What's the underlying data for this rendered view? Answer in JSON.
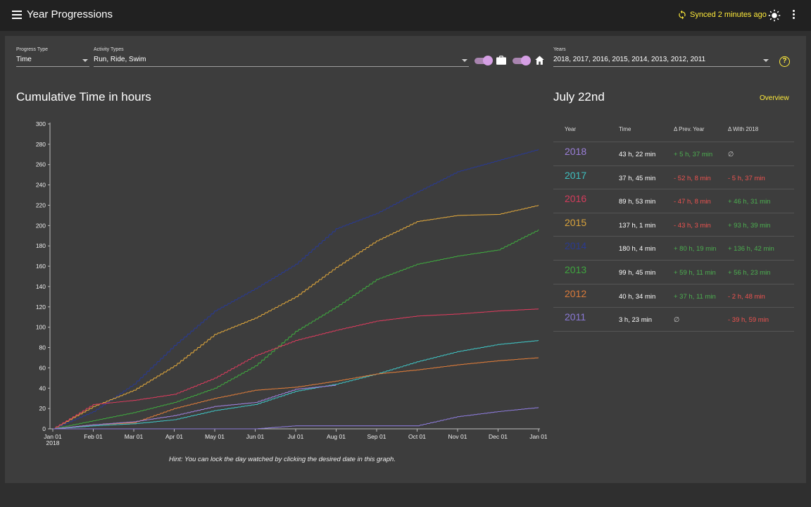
{
  "app": {
    "title": "Year Progressions",
    "sync_text": "Synced 2 minutes ago"
  },
  "filters": {
    "progress_type": {
      "label": "Progress Type",
      "value": "Time"
    },
    "activity_types": {
      "label": "Activity Types",
      "value": "Run, Ride, Swim"
    },
    "years": {
      "label": "Years",
      "value": "2018, 2017, 2016, 2015, 2014, 2013, 2012, 2011"
    },
    "toggle_commute": {
      "on": true,
      "icon": "briefcase-icon"
    },
    "toggle_home": {
      "on": true,
      "icon": "home-icon"
    },
    "help_icon": "?"
  },
  "chart_section": {
    "title": "Cumulative Time in hours",
    "hint": "Hint: You can lock the day watched by clicking the desired date in this graph."
  },
  "chart_data": {
    "type": "line",
    "title": "Cumulative Time in hours",
    "x_ticks": [
      "Jan 01",
      "Feb 01",
      "Mar 01",
      "Apr 01",
      "May 01",
      "Jun 01",
      "Jul 01",
      "Aug 01",
      "Sep 01",
      "Oct 01",
      "Nov 01",
      "Dec 01",
      "Jan 01"
    ],
    "x_sub_label": "2018",
    "ylim": [
      0,
      300
    ],
    "y_ticks": [
      0,
      20,
      40,
      60,
      80,
      100,
      120,
      140,
      160,
      180,
      200,
      220,
      240,
      260,
      280,
      300
    ],
    "x_months": [
      0,
      1,
      2,
      3,
      4,
      5,
      6,
      7,
      8,
      9,
      10,
      11,
      12
    ],
    "series": [
      {
        "name": "2014",
        "color": "#2a3a8f",
        "values": [
          0,
          17,
          44,
          82,
          116,
          138,
          162,
          197,
          212,
          233,
          253,
          264,
          275
        ]
      },
      {
        "name": "2015",
        "color": "#d9a33c",
        "values": [
          0,
          22,
          38,
          62,
          93,
          109,
          130,
          159,
          185,
          204,
          210,
          211,
          220
        ]
      },
      {
        "name": "2013",
        "color": "#3fa53f",
        "values": [
          0,
          8,
          16,
          26,
          40,
          62,
          96,
          120,
          147,
          162,
          170,
          176,
          196
        ]
      },
      {
        "name": "2016",
        "color": "#d43c5c",
        "values": [
          0,
          24,
          28,
          34,
          50,
          72,
          87,
          97,
          106,
          111,
          113,
          116,
          118
        ]
      },
      {
        "name": "2017",
        "color": "#3fbfbf",
        "values": [
          0,
          3,
          5,
          9,
          18,
          24,
          37,
          44,
          54,
          66,
          76,
          83,
          87
        ]
      },
      {
        "name": "2012",
        "color": "#d97a3a",
        "values": [
          0,
          4,
          6,
          20,
          30,
          38,
          41,
          47,
          54,
          58,
          63,
          67,
          70
        ]
      },
      {
        "name": "2018",
        "color": "#9b7fd9",
        "values": [
          0,
          4,
          7,
          13,
          22,
          26,
          39,
          43
        ]
      },
      {
        "name": "2011",
        "color": "#8a79d6",
        "values": [
          0,
          0,
          0,
          0,
          0,
          0,
          3,
          3,
          3,
          3,
          12,
          17,
          21
        ]
      }
    ]
  },
  "detail": {
    "date_title": "July 22nd",
    "overview_link": "Overview",
    "headers": {
      "year": "Year",
      "time": "Time",
      "prev": "Δ Prev. Year",
      "with": "Δ With 2018"
    },
    "rows": [
      {
        "year": "2018",
        "color": "#9b7fd9",
        "time": "43 h, 22 min",
        "prev": "+ 5 h, 37 min",
        "prev_color": "#4caf50",
        "with": "∅",
        "with_color": "#ccc"
      },
      {
        "year": "2017",
        "color": "#3fbfbf",
        "time": "37 h, 45 min",
        "prev": "- 52 h, 8 min",
        "prev_color": "#ef5350",
        "with": "- 5 h, 37 min",
        "with_color": "#ef5350"
      },
      {
        "year": "2016",
        "color": "#d43c5c",
        "time": "89 h, 53 min",
        "prev": "- 47 h, 8 min",
        "prev_color": "#ef5350",
        "with": "+ 46 h, 31 min",
        "with_color": "#4caf50"
      },
      {
        "year": "2015",
        "color": "#d9a33c",
        "time": "137 h, 1 min",
        "prev": "- 43 h, 3 min",
        "prev_color": "#ef5350",
        "with": "+ 93 h, 39 min",
        "with_color": "#4caf50"
      },
      {
        "year": "2014",
        "color": "#2a3a8f",
        "time": "180 h, 4 min",
        "prev": "+ 80 h, 19 min",
        "prev_color": "#4caf50",
        "with": "+ 136 h, 42 min",
        "with_color": "#4caf50"
      },
      {
        "year": "2013",
        "color": "#3fa53f",
        "time": "99 h, 45 min",
        "prev": "+ 59 h, 11 min",
        "prev_color": "#4caf50",
        "with": "+ 56 h, 23 min",
        "with_color": "#4caf50"
      },
      {
        "year": "2012",
        "color": "#d97a3a",
        "time": "40 h, 34 min",
        "prev": "+ 37 h, 11 min",
        "prev_color": "#4caf50",
        "with": "- 2 h, 48 min",
        "with_color": "#ef5350"
      },
      {
        "year": "2011",
        "color": "#8a79d6",
        "time": "3 h, 23 min",
        "prev": "∅",
        "prev_color": "#ccc",
        "with": "- 39 h, 59 min",
        "with_color": "#ef5350"
      }
    ]
  }
}
